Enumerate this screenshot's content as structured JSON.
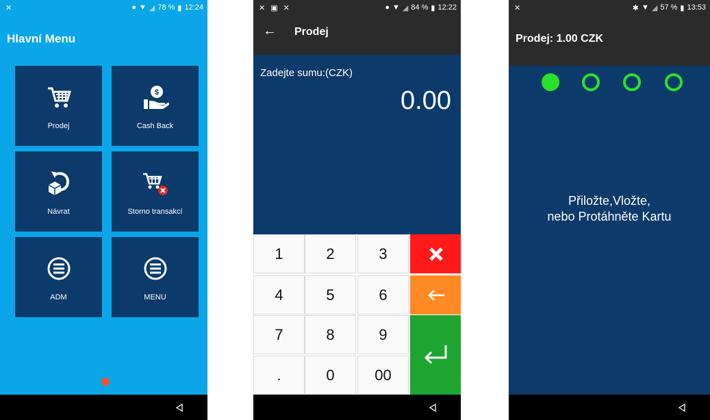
{
  "screen1": {
    "status": {
      "battery": "78 %",
      "time": "12:24"
    },
    "title": "Hlavní Menu",
    "tiles": [
      {
        "label": "Prodej",
        "icon": "cart-icon"
      },
      {
        "label": "Cash Back",
        "icon": "cash-back-icon"
      },
      {
        "label": "Návrat",
        "icon": "return-box-icon"
      },
      {
        "label": "Storno transakcí",
        "icon": "cart-cancel-icon"
      },
      {
        "label": "ADM",
        "icon": "menu-circle-icon"
      },
      {
        "label": "MENU",
        "icon": "menu-circle-icon"
      }
    ]
  },
  "screen2": {
    "status": {
      "battery": "84 %",
      "time": "12:22"
    },
    "title": "Prodej",
    "prompt": "Zadejte sumu:(CZK)",
    "amount": "0.00",
    "keys": [
      "1",
      "2",
      "3",
      "4",
      "5",
      "6",
      "7",
      "8",
      "9",
      ".",
      "0",
      "00"
    ],
    "colors": {
      "cancel": "#ff1a1a",
      "backspace": "#ff8a24",
      "enter": "#1ea431"
    }
  },
  "screen3": {
    "status": {
      "battery": "57 %",
      "time": "13:53"
    },
    "title": "Prodej: 1.00 CZK",
    "message_line1": "Přiložte,Vložte,",
    "message_line2": "nebo Protáhněte Kartu",
    "progress": {
      "total": 4,
      "active": 1
    }
  }
}
